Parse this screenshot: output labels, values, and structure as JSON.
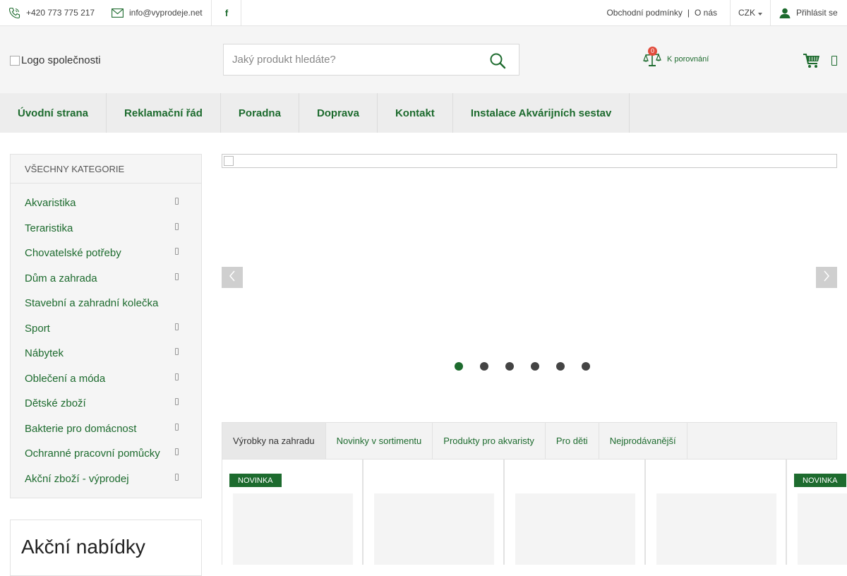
{
  "topbar": {
    "phone": "+420 773 775 217",
    "email": "info@vyprodeje.net",
    "links": [
      "Obchodní podmínky",
      "O nás"
    ],
    "link_separator": "|",
    "currency": "CZK",
    "login": "Přihlásit se"
  },
  "header": {
    "logo_alt": "Logo společnosti",
    "search_placeholder": "Jaký produkt hledáte?",
    "compare_count": "0",
    "compare_label": "K porovnání"
  },
  "nav": {
    "items": [
      "Úvodní strana",
      "Reklamační řád",
      "Poradna",
      "Doprava",
      "Kontakt",
      "Instalace Akvárijních sestav"
    ]
  },
  "categories": {
    "title": "VŠECHNY KATEGORIE",
    "items": [
      {
        "label": "Akvaristika",
        "has_sub": true
      },
      {
        "label": "Teraristika",
        "has_sub": true
      },
      {
        "label": "Chovatelské potřeby",
        "has_sub": true
      },
      {
        "label": "Dům a zahrada",
        "has_sub": true
      },
      {
        "label": "Stavební a zahradní kolečka",
        "has_sub": false
      },
      {
        "label": "Sport",
        "has_sub": true
      },
      {
        "label": "Nábytek",
        "has_sub": true
      },
      {
        "label": "Oblečení a móda",
        "has_sub": true
      },
      {
        "label": "Dětské zboží",
        "has_sub": true
      },
      {
        "label": "Bakterie pro domácnost",
        "has_sub": true
      },
      {
        "label": "Ochranné pracovní pomůcky",
        "has_sub": true
      },
      {
        "label": "Akční zboží - výprodej",
        "has_sub": true
      }
    ]
  },
  "promo": {
    "title": "Akční nabídky"
  },
  "slider": {
    "slide_count": 6,
    "active_slide": 1
  },
  "tabs": {
    "items": [
      "Výrobky na zahradu",
      "Novinky v sortimentu",
      "Produkty pro akvaristy",
      "Pro děti",
      "Nejprodávanější"
    ],
    "active": 0
  },
  "products": {
    "badge_label": "NOVINKA",
    "items": [
      {
        "badge": true
      },
      {
        "badge": false
      },
      {
        "badge": false
      },
      {
        "badge": false
      },
      {
        "badge": true
      }
    ]
  },
  "colors": {
    "brand_green": "#1d6b2e",
    "badge_red": "#e24b3b"
  }
}
